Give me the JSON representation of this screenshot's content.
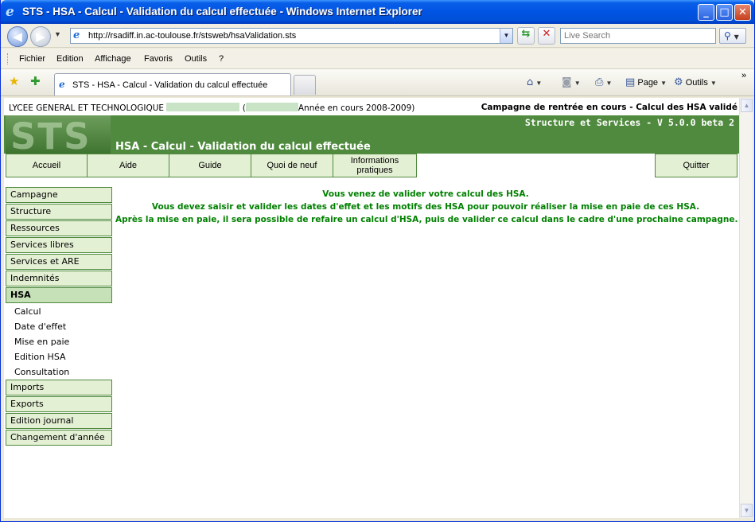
{
  "window": {
    "title": "STS - HSA - Calcul - Validation du calcul effectuée - Windows Internet Explorer",
    "buttons": {
      "minimize": "_",
      "maximize": "□",
      "close": "✕"
    }
  },
  "address_bar": {
    "url": "http://rsadiff.in.ac-toulouse.fr/stsweb/hsaValidation.sts",
    "search_placeholder": "Live Search",
    "back_glyph": "◀",
    "forward_glyph": "▶"
  },
  "menu": {
    "items": [
      "Fichier",
      "Edition",
      "Affichage",
      "Favoris",
      "Outils",
      "?"
    ]
  },
  "tabs": {
    "active_label": "STS - HSA - Calcul - Validation du calcul effectuée"
  },
  "command_bar": {
    "page_label": "Page",
    "tools_label": "Outils"
  },
  "page": {
    "school_name": "LYCEE GENERAL ET TECHNOLOGIQUE",
    "school_year_prefix": "(",
    "school_year": "Année en cours 2008-2009)",
    "campaign_status": "Campagne de rentrée en cours - Calcul des HSA validé",
    "version": "Structure et Services - V 5.0.0 beta 2",
    "logo_text": "STS",
    "page_title": "HSA - Calcul - Validation du calcul effectuée"
  },
  "top_nav": {
    "home": "Accueil",
    "help": "Aide",
    "guide": "Guide",
    "whats_new": "Quoi de neuf",
    "info_line1": "Informations",
    "info_line2": "pratiques",
    "quit": "Quitter"
  },
  "sidebar": {
    "items_top": [
      "Campagne",
      "Structure",
      "Ressources",
      "Services libres",
      "Services et ARE",
      "Indemnités"
    ],
    "active": "HSA",
    "sub_items": [
      "Calcul",
      "Date d'effet",
      "Mise en paie",
      "Edition HSA",
      "Consultation"
    ],
    "items_bottom": [
      "Imports",
      "Exports",
      "Edition journal",
      "Changement d'année"
    ]
  },
  "messages": [
    "Vous venez de valider votre calcul des HSA.",
    "Vous devez saisir et valider les dates d'effet et les motifs des HSA pour pouvoir réaliser la mise en paie de ces HSA.",
    "Après la mise en paie, il sera possible de refaire un calcul d'HSA, puis de valider ce calcul dans le cadre d'une prochaine campagne."
  ],
  "colors": {
    "banner_green": "#4f8a3e",
    "nav_bg": "#e4f0d4",
    "nav_border": "#4e8a3d",
    "message_green": "#008000",
    "titlebar_blue": "#0054e3"
  }
}
